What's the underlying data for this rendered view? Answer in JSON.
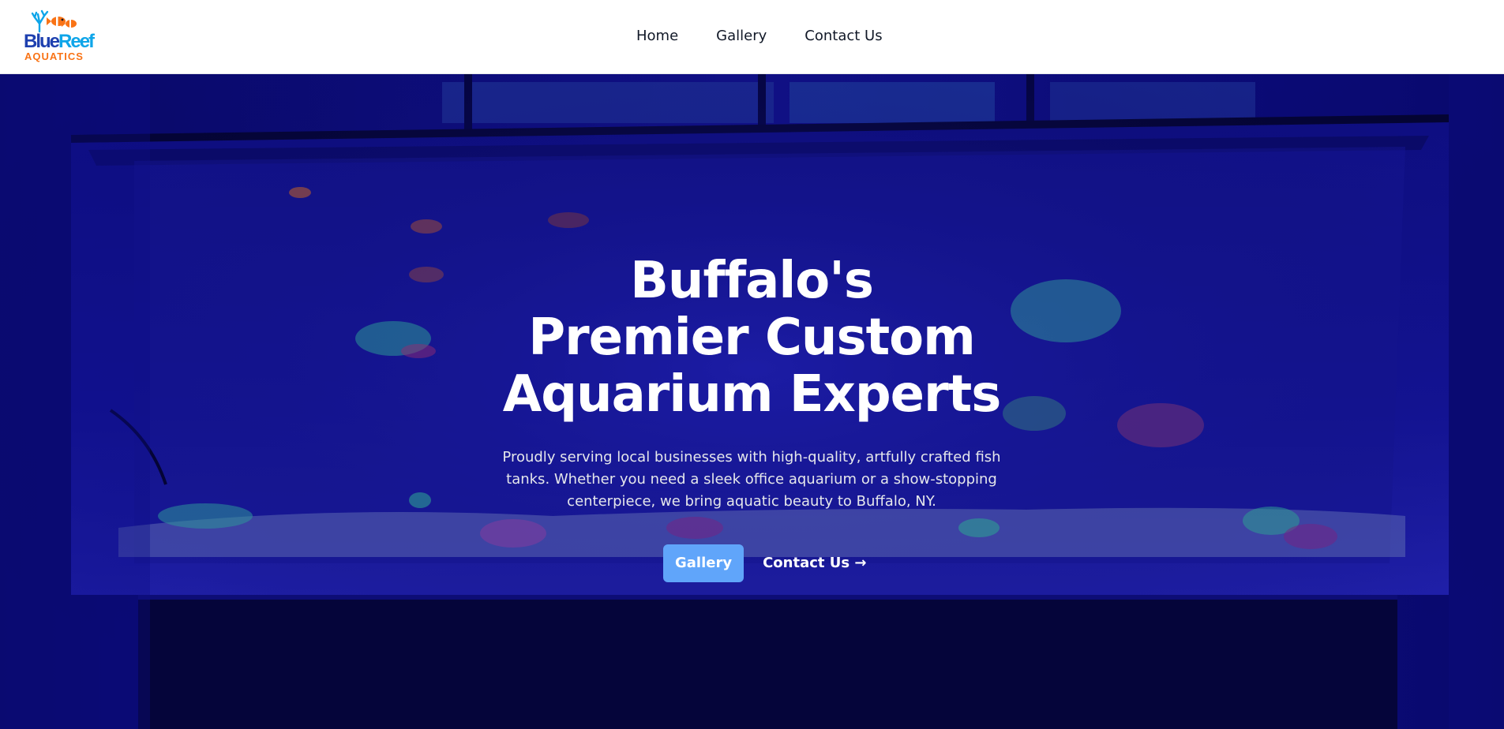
{
  "header": {
    "logo": {
      "word_blue": "Blue",
      "word_reef": "Reef",
      "sub": "AQUATICS"
    },
    "nav": [
      {
        "label": "Home"
      },
      {
        "label": "Gallery"
      },
      {
        "label": "Contact Us"
      }
    ]
  },
  "hero": {
    "title_lines": [
      "Buffalo's",
      "Premier Custom",
      "Aquarium Experts"
    ],
    "description": "Proudly serving local businesses with high-quality, artfully crafted fish tanks. Whether you need a sleek office aquarium or a show-stopping centerpiece, we bring aquatic beauty to Buffalo, NY.",
    "primary_button": "Gallery",
    "secondary_link": "Contact Us →"
  },
  "colors": {
    "brand_blue": "#1e40af",
    "brand_light_blue": "#0ea5e9",
    "brand_orange": "#f97316",
    "button_blue": "#60a5fa",
    "hero_tint": "#0b0b7a"
  }
}
